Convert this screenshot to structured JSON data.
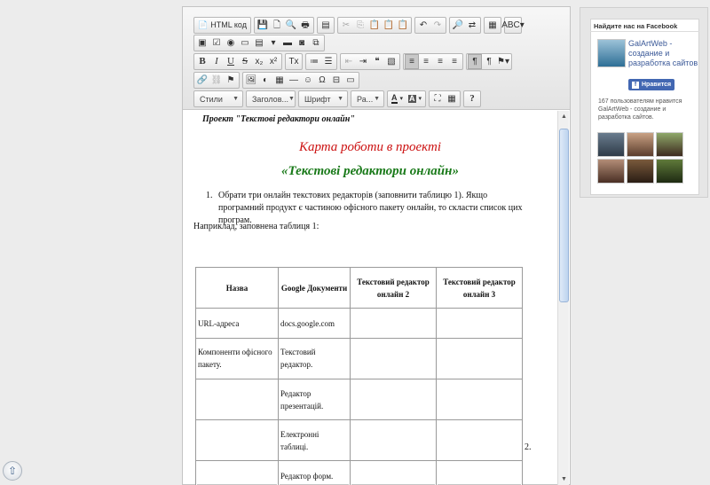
{
  "toolbar": {
    "row1": [
      {
        "name": "html-source-button",
        "label": "HTML код",
        "icon": "📄",
        "group": 1
      },
      {
        "name": "save-button",
        "icon": "💾",
        "group": 2
      },
      {
        "name": "new-page-button",
        "icon": "🗋",
        "group": 2
      },
      {
        "name": "preview-button",
        "icon": "🔍",
        "group": 2
      },
      {
        "name": "print-button",
        "icon": "🖶",
        "group": 2
      },
      {
        "name": "templates-button",
        "icon": "▤",
        "group": 3
      },
      {
        "name": "cut-button",
        "icon": "✂",
        "dim": true,
        "group": 4
      },
      {
        "name": "copy-button",
        "icon": "⎘",
        "dim": true,
        "group": 4
      },
      {
        "name": "paste-button",
        "icon": "📋",
        "group": 4
      },
      {
        "name": "paste-text-button",
        "icon": "📋",
        "group": 4
      },
      {
        "name": "paste-word-button",
        "icon": "📋",
        "group": 4
      },
      {
        "name": "undo-button",
        "icon": "↶",
        "group": 5
      },
      {
        "name": "redo-button",
        "icon": "↷",
        "dim": true,
        "group": 5
      },
      {
        "name": "find-button",
        "icon": "🔎",
        "group": 6
      },
      {
        "name": "replace-button",
        "icon": "⇄",
        "group": 6
      },
      {
        "name": "select-all-button",
        "icon": "▦",
        "group": 7
      },
      {
        "name": "spellcheck-button",
        "icon": "ABC▾",
        "group": 8
      }
    ],
    "row2": [
      {
        "name": "form-button",
        "icon": "▣"
      },
      {
        "name": "checkbox-button",
        "icon": "☑"
      },
      {
        "name": "radio-button",
        "icon": "◉"
      },
      {
        "name": "textfield-button",
        "icon": "▭"
      },
      {
        "name": "textarea-button",
        "icon": "▤"
      },
      {
        "name": "select-button",
        "icon": "▾"
      },
      {
        "name": "button-button",
        "icon": "▬"
      },
      {
        "name": "imagebutton-button",
        "icon": "◙"
      },
      {
        "name": "hiddenfield-button",
        "icon": "⧉"
      }
    ],
    "row3": [
      {
        "name": "bold-button",
        "label": "B",
        "style": "bold",
        "group": 1
      },
      {
        "name": "italic-button",
        "label": "I",
        "style": "ital",
        "group": 1
      },
      {
        "name": "underline-button",
        "label": "U",
        "style": "und",
        "group": 1
      },
      {
        "name": "strike-button",
        "label": "S",
        "style": "strk",
        "group": 1
      },
      {
        "name": "subscript-button",
        "label": "x₂",
        "group": 1
      },
      {
        "name": "superscript-button",
        "label": "x²",
        "group": 1
      },
      {
        "name": "remove-format-button",
        "label": "Tx",
        "group": 2
      },
      {
        "name": "numbered-list-button",
        "icon": "≔",
        "group": 3
      },
      {
        "name": "bulleted-list-button",
        "icon": "☰",
        "group": 3
      },
      {
        "name": "outdent-button",
        "icon": "⇤",
        "dim": true,
        "group": 4
      },
      {
        "name": "indent-button",
        "icon": "⇥",
        "group": 4
      },
      {
        "name": "blockquote-button",
        "icon": "❝",
        "group": 4
      },
      {
        "name": "div-button",
        "icon": "▧",
        "group": 4
      },
      {
        "name": "align-left-button",
        "icon": "≡",
        "active": true,
        "group": 5
      },
      {
        "name": "align-center-button",
        "icon": "≡",
        "group": 5
      },
      {
        "name": "align-right-button",
        "icon": "≡",
        "group": 5
      },
      {
        "name": "align-justify-button",
        "icon": "≡",
        "group": 5
      },
      {
        "name": "ltr-button",
        "icon": "¶",
        "active": true,
        "group": 6
      },
      {
        "name": "rtl-button",
        "icon": "¶",
        "group": 6
      },
      {
        "name": "language-button",
        "icon": "⚑▾",
        "group": 6
      }
    ],
    "row4": [
      {
        "name": "link-button",
        "icon": "🔗",
        "group": 1
      },
      {
        "name": "unlink-button",
        "icon": "⛓",
        "dim": true,
        "group": 1
      },
      {
        "name": "anchor-button",
        "icon": "⚑",
        "group": 1
      },
      {
        "name": "image-button",
        "icon": "🖼",
        "group": 2
      },
      {
        "name": "flash-button",
        "icon": "◐",
        "group": 2
      },
      {
        "name": "table-button",
        "icon": "▦",
        "group": 2
      },
      {
        "name": "hline-button",
        "icon": "―",
        "group": 2
      },
      {
        "name": "smiley-button",
        "icon": "☺",
        "group": 2
      },
      {
        "name": "special-char-button",
        "icon": "Ω",
        "group": 2
      },
      {
        "name": "pagebreak-button",
        "icon": "⊟",
        "group": 2
      },
      {
        "name": "iframe-button",
        "icon": "▭",
        "group": 2
      }
    ],
    "row5": {
      "styles_label": "Стили",
      "heading_label": "Заголов...",
      "font_label": "Шрифт",
      "size_label": "Ра...",
      "text_color_icon": "A",
      "bg_color_icon": "A",
      "maximize_icon": "⛶",
      "show_blocks_icon": "▦",
      "help_icon": "?"
    }
  },
  "document": {
    "project_line": "Проект \"Текстові редактори онлайн\"",
    "title_line1": "Карта роботи в проекті",
    "title_line2": "«Текстові редактори онлайн»",
    "task_number": "1.",
    "task_text": "Обрати три онлайн текстових редакторів (заповнити таблицю 1). Якщо програмний продукт є частиною офісного пакету онлайн, то скласти список цих програм.",
    "example_text": "Наприклад, заповнена таблиця 1:",
    "table": {
      "headers": [
        "Назва",
        "Google Документи",
        "Текстовий редактор онлайн 2",
        "Текстовий редактор онлайн 3"
      ],
      "rows": [
        [
          "URL-адреса",
          "docs.google.com",
          "",
          ""
        ],
        [
          "Компоненти офісного пакету.",
          "Текстовий редактор.",
          "",
          ""
        ],
        [
          "",
          "Редактор презентацій.",
          "",
          ""
        ],
        [
          "",
          "Електронні таблиці.",
          "",
          ""
        ],
        [
          "",
          "Редактор форм.",
          "",
          ""
        ]
      ]
    },
    "stray_number": "2."
  },
  "facebook": {
    "heading": "Найдите нас на Facebook",
    "page_name": "GalArtWeb - создание и разработка сайтов",
    "like_label": "Нравится",
    "like_count_text": "167 пользователям нравится GalArtWeb - создание и разработка сайтов."
  },
  "colors": {
    "title_red": "#cc1111",
    "title_green": "#1a7a1a",
    "facebook_blue": "#4267b2"
  }
}
